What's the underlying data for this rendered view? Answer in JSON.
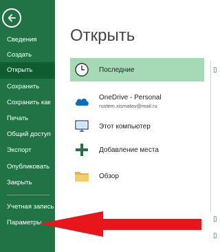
{
  "sidebar": {
    "items": [
      {
        "label": "Сведения"
      },
      {
        "label": "Создать"
      },
      {
        "label": "Открыть"
      },
      {
        "label": "Сохранить"
      },
      {
        "label": "Сохранить как"
      },
      {
        "label": "Печать"
      },
      {
        "label": "Общий доступ"
      },
      {
        "label": "Экспорт"
      },
      {
        "label": "Опубликовать"
      },
      {
        "label": "Закрыть"
      }
    ],
    "bottom_items": [
      {
        "label": "Учетная запись"
      },
      {
        "label": "Параметры"
      }
    ],
    "active_index": 2
  },
  "main": {
    "title": "Открыть",
    "locations": [
      {
        "label": "Последние",
        "icon": "clock-icon"
      },
      {
        "label": "OneDrive - Personal",
        "sublabel": "rustem.xismatov@mail.ru",
        "icon": "cloud-icon"
      },
      {
        "label": "Этот компьютер",
        "icon": "computer-icon"
      },
      {
        "label": "Добавление места",
        "icon": "plus-icon"
      },
      {
        "label": "Обзор",
        "icon": "folder-icon"
      }
    ]
  },
  "colors": {
    "sidebar_bg": "#217346",
    "sidebar_active": "#0e5c2f",
    "selected_location": "#a6d9b5",
    "arrow": "#e8151b"
  }
}
